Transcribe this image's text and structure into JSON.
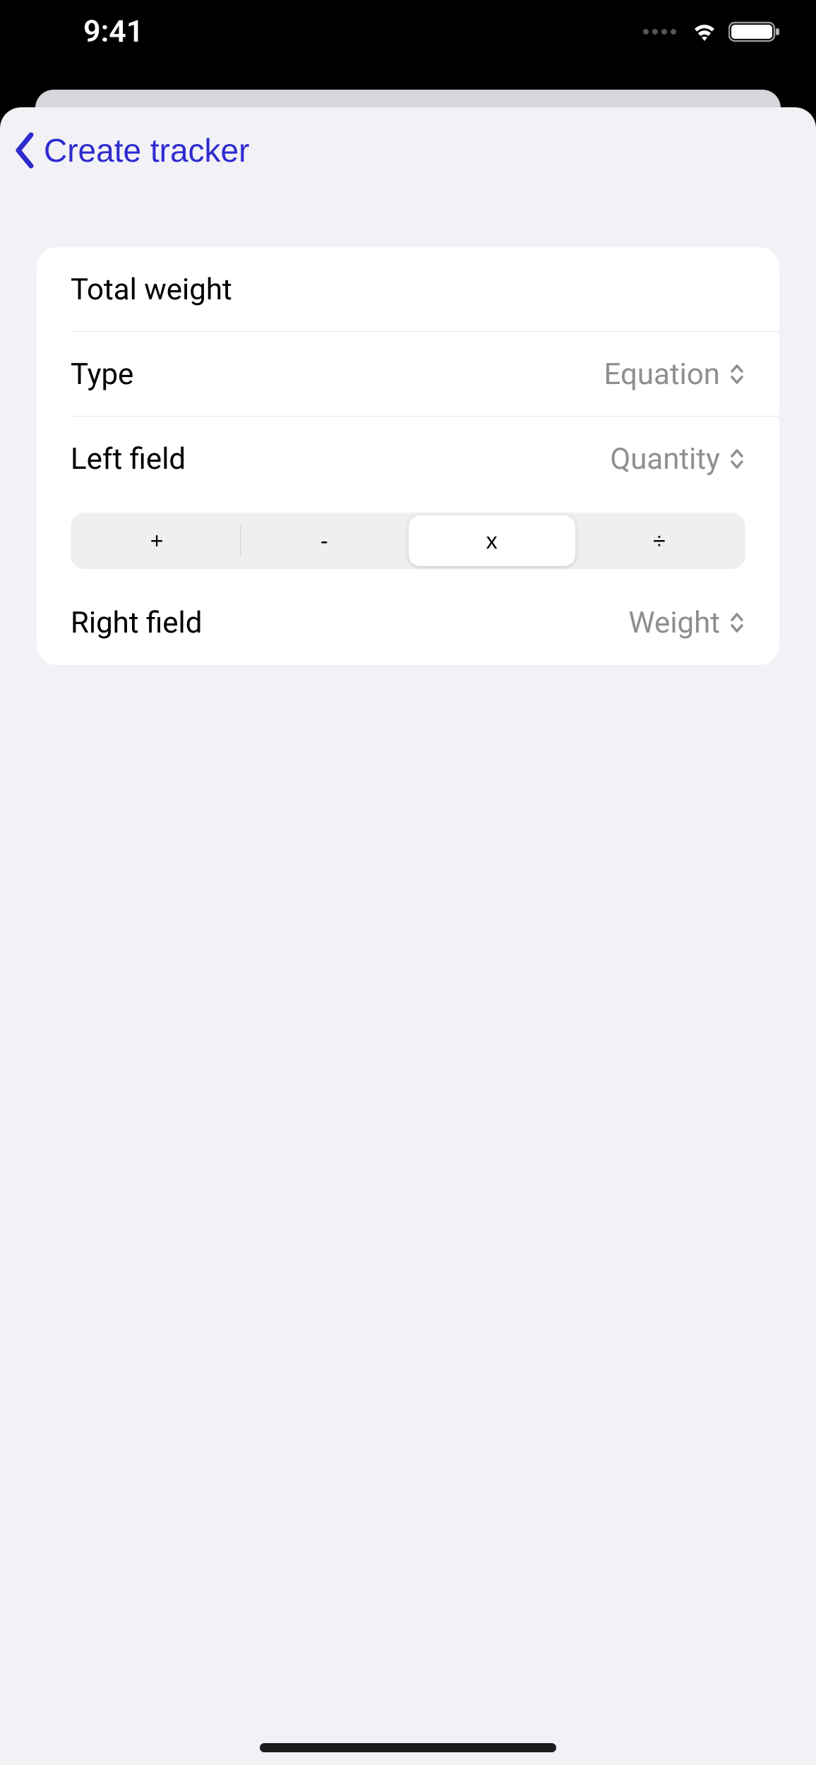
{
  "status": {
    "time": "9:41"
  },
  "nav": {
    "back_label": "Create tracker"
  },
  "form": {
    "title": "Total weight",
    "type_label": "Type",
    "type_value": "Equation",
    "left_field_label": "Left field",
    "left_field_value": "Quantity",
    "right_field_label": "Right field",
    "right_field_value": "Weight",
    "operators": {
      "plus": "+",
      "minus": "-",
      "multiply": "x",
      "divide": "÷",
      "selected": "multiply"
    }
  }
}
